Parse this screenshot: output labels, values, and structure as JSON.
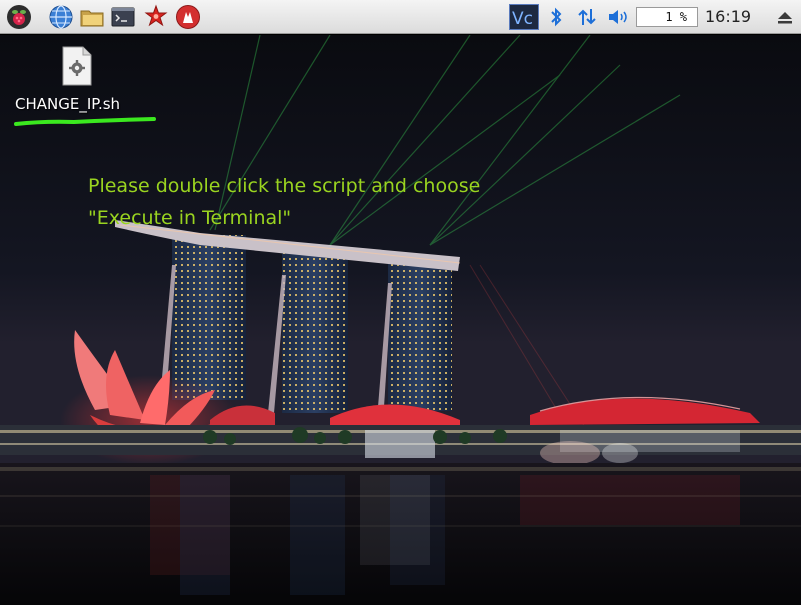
{
  "taskbar": {
    "launchers": [
      {
        "name": "raspberry-menu-icon"
      },
      {
        "name": "web-browser-icon"
      },
      {
        "name": "file-manager-icon"
      },
      {
        "name": "terminal-icon"
      },
      {
        "name": "math-kernel-icon"
      },
      {
        "name": "wolfram-icon"
      }
    ],
    "tray": {
      "vnc_label": "Vc",
      "cpu_usage": "1 %",
      "clock": "16:19",
      "icons": [
        "bluetooth-icon",
        "network-icon",
        "volume-icon",
        "eject-icon"
      ]
    }
  },
  "desktop": {
    "file_icon": {
      "label": "CHANGE_IP.sh"
    },
    "instruction_line1": "Please double click the script and choose",
    "instruction_line2": "\"Execute in Terminal\"",
    "annotation_color": "#3be81f",
    "text_color": "#9ad420"
  }
}
